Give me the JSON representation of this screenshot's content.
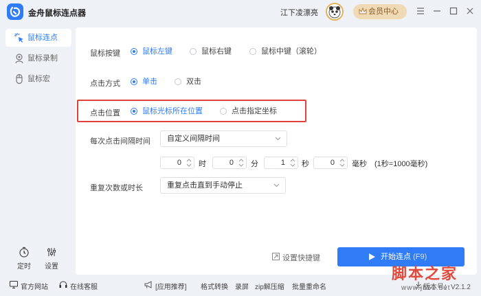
{
  "app": {
    "title": "金舟鼠标连点器",
    "username": "江下凌漂亮",
    "vip_label": "会员中心"
  },
  "sidebar": {
    "items": [
      {
        "label": "鼠标连点",
        "active": true
      },
      {
        "label": "鼠标录制",
        "active": false
      },
      {
        "label": "鼠标宏",
        "active": false
      }
    ],
    "tools": [
      {
        "label": "定时"
      },
      {
        "label": "设置"
      }
    ]
  },
  "settings": {
    "mouse_button": {
      "label": "鼠标按键",
      "options": [
        "鼠标左键",
        "鼠标右键",
        "鼠标中键（滚轮）"
      ],
      "selected": 0
    },
    "click_mode": {
      "label": "点击方式",
      "options": [
        "单击",
        "双击"
      ],
      "selected": 0
    },
    "click_position": {
      "label": "点击位置",
      "options": [
        "鼠标光标所在位置",
        "点击指定坐标"
      ],
      "selected": 0
    },
    "interval": {
      "label": "每次点击间隔时间",
      "select_value": "自定义间隔时间",
      "hours": "0",
      "hours_unit": "时",
      "minutes": "0",
      "minutes_unit": "分",
      "seconds": "1",
      "seconds_unit": "秒",
      "ms": "0",
      "ms_unit": "毫秒",
      "note": "(1秒=1000毫秒)"
    },
    "repeat": {
      "label": "重复次数或时长",
      "select_value": "重复点击直到手动停止"
    }
  },
  "actions": {
    "shortcut_label": "设置快捷键",
    "start_label": "开始连点",
    "start_hotkey": "(F9)"
  },
  "bottombar": {
    "website": "官方网站",
    "support": "在线客服",
    "recommend": "[应用推荐]",
    "apps": [
      "格式转换",
      "录屏",
      "zip解压缩",
      "批量重命名"
    ],
    "version": "版本号：V2.1.2"
  },
  "watermark": {
    "text": "脚本之家",
    "url": "www.jb51.net"
  },
  "colors": {
    "accent": "#2f7cf6",
    "highlight": "#e0413a",
    "vip": "#f0d9b5"
  }
}
